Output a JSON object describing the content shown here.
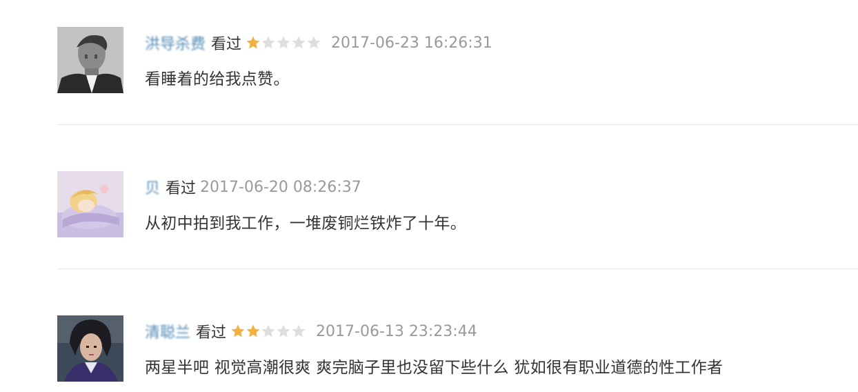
{
  "colors": {
    "username": "#3377aa",
    "star_on": "#f4b03f",
    "star_off": "#dedede",
    "time": "#999999",
    "text": "#333333",
    "divider": "#e8e8e8"
  },
  "comments": [
    {
      "username": "洪导杀费",
      "status": "看过",
      "rating": 1,
      "rating_max": 5,
      "time": "2017-06-23 16:26:31",
      "content": "看睡着的给我点赞。"
    },
    {
      "username": "贝",
      "status": "看过",
      "rating": 0,
      "rating_max": 0,
      "time": "2017-06-20 08:26:37",
      "content": "从初中拍到我工作，一堆废铜烂铁炸了十年。"
    },
    {
      "username": "清聪兰",
      "status": "看过",
      "rating": 2,
      "rating_max": 5,
      "time": "2017-06-13 23:23:44",
      "content": "两星半吧 视觉高潮很爽 爽完脑子里也没留下些什么 犹如很有职业道德的性工作者"
    }
  ]
}
